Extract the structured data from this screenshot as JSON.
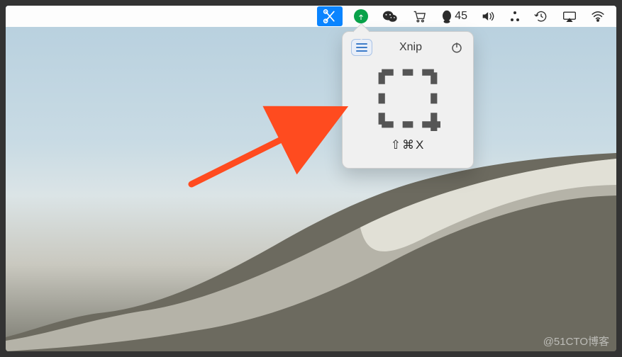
{
  "menubar": {
    "qq_count": "45"
  },
  "popover": {
    "title": "Xnip",
    "shortcut": "⇧⌘X"
  },
  "watermark": "@51CTO博客"
}
